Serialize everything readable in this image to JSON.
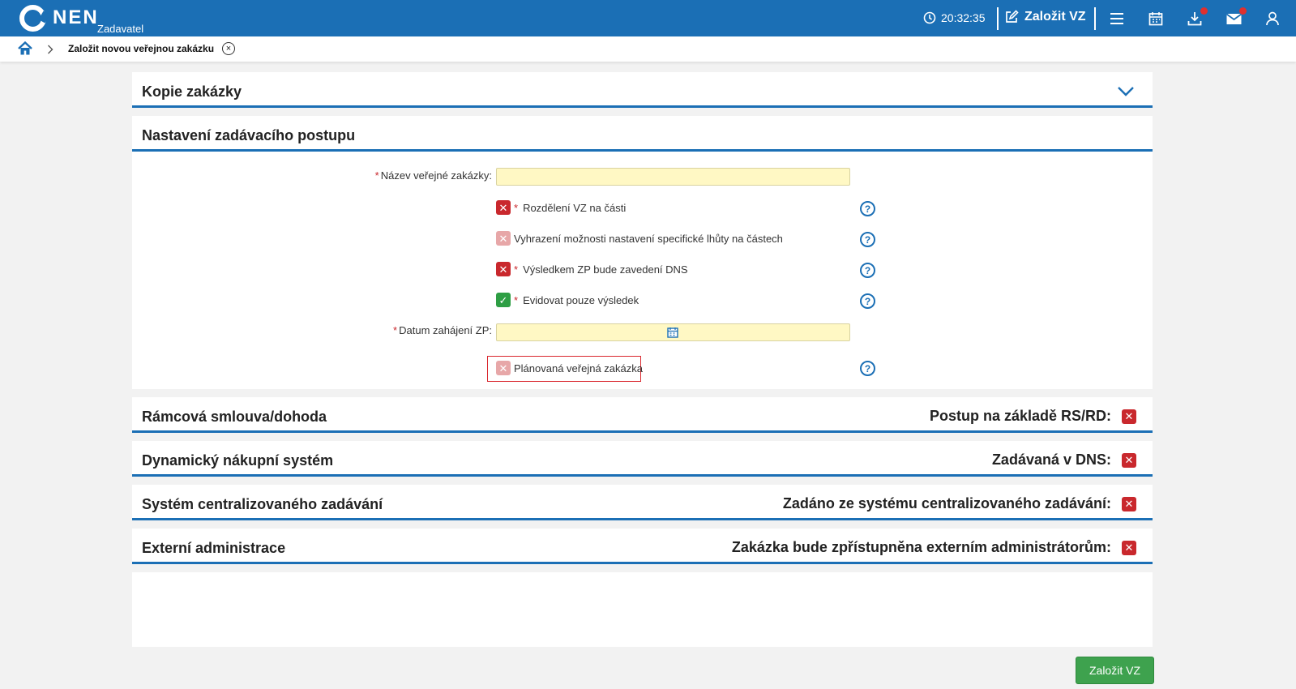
{
  "app": {
    "logo_text": "NEN",
    "logo_sub": "Zadavatel"
  },
  "topbar": {
    "clock": "20:32:35",
    "create_label": "Založit VZ",
    "icons": [
      "menu-icon",
      "calendar-icon",
      "download-icon",
      "mail-icon",
      "user-icon"
    ],
    "brand_color": "#1b6fb5",
    "badge_color": "#e0302e"
  },
  "breadcrumb": {
    "current": "Založit novou veřejnou zakázku"
  },
  "sections": {
    "copy": {
      "title": "Kopie zakázky"
    },
    "procedure": {
      "title": "Nastavení zadávacího postupu",
      "name_label": "Název veřejné zakázky:",
      "name_value": "",
      "split_label": "Rozdělení VZ na části",
      "split_state": "✕",
      "reserve_label": "Vyhrazení možnosti nastavení specifické lhůty na částech",
      "reserve_state": "✕",
      "dns_label": "Výsledkem ZP bude zavedení DNS",
      "dns_state": "✕",
      "result_label": "Evidovat pouze výsledek",
      "result_state": "✓",
      "date_label": "Datum zahájení ZP:",
      "date_value": "",
      "planned_label": "Plánovaná veřejná zakázka",
      "planned_state": "✕",
      "help_glyph": "?",
      "required_mark": "*"
    },
    "framework": {
      "title": "Rámcová smlouva/dohoda",
      "right_label": "Postup na základě RS/RD:",
      "state": "✕"
    },
    "dns": {
      "title": "Dynamický nákupní systém",
      "right_label": "Zadávaná v DNS:",
      "state": "✕"
    },
    "central": {
      "title": "Systém centralizovaného zadávání",
      "right_label": "Zadáno ze systému centralizovaného zadávání:",
      "state": "✕"
    },
    "external": {
      "title": "Externí administrace",
      "right_label": "Zakázka bude zpřístupněna externím administrátorům:",
      "state": "✕"
    }
  },
  "actions": {
    "submit_label": "Založit VZ"
  },
  "colors": {
    "checked": "#2e9e44",
    "unchecked": "#c9282d",
    "disabled": "#e7a7a8",
    "required_field": "#fff8c4",
    "submit": "#3ea24e"
  }
}
